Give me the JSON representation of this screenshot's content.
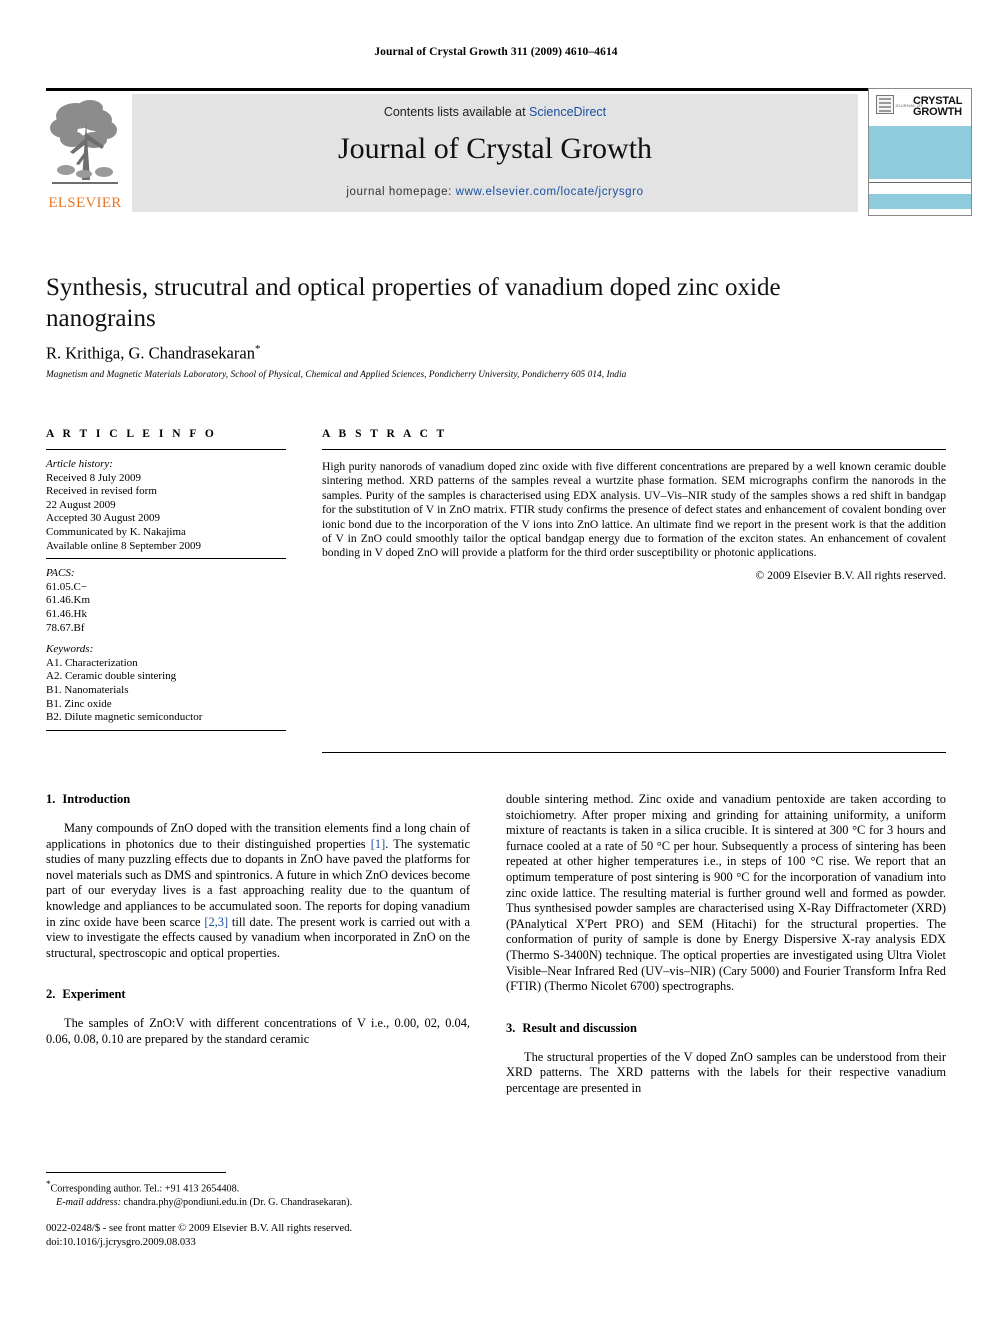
{
  "running_head": "Journal of Crystal Growth 311 (2009) 4610–4614",
  "masthead": {
    "publisher_word": "ELSEVIER",
    "contents_prefix": "Contents lists available at ",
    "contents_link": "ScienceDirect",
    "journal_name": "Journal of Crystal Growth",
    "homepage_prefix": "journal homepage: ",
    "homepage_url": "www.elsevier.com/locate/jcrysgro",
    "cover": {
      "mini_label": "JOURNAL OF",
      "line1": "CRYSTAL",
      "line2": "GROWTH"
    }
  },
  "article": {
    "title": "Synthesis, strucutral and optical properties of vanadium doped zinc oxide nanograins",
    "authors": "R. Krithiga, G. Chandrasekaran",
    "author_marker": "*",
    "affiliation": "Magnetism and Magnetic Materials Laboratory, School of Physical, Chemical and Applied Sciences, Pondicherry University, Pondicherry 605 014, India"
  },
  "article_info": {
    "heading": "A R T I C L E    I N F O",
    "history_label": "Article history:",
    "history": [
      "Received 8 July 2009",
      "Received in revised form",
      "22 August 2009",
      "Accepted 30 August 2009",
      "Communicated by K. Nakajima",
      "Available online 8 September 2009"
    ],
    "pacs_label": "PACS:",
    "pacs": [
      "61.05.C−",
      "61.46.Km",
      "61.46.Hk",
      "78.67.Bf"
    ],
    "keywords_label": "Keywords:",
    "keywords": [
      "A1. Characterization",
      "A2. Ceramic double sintering",
      "B1. Nanomaterials",
      "B1. Zinc oxide",
      "B2. Dilute magnetic semiconductor"
    ]
  },
  "abstract": {
    "heading": "A B S T R A C T",
    "text": "High purity nanorods of vanadium doped zinc oxide with five different concentrations are prepared by a well known ceramic double sintering method. XRD patterns of the samples reveal a wurtzite phase formation. SEM micrographs confirm the nanorods in the samples. Purity of the samples is characterised using EDX analysis. UV–Vis–NIR study of the samples shows a red shift in bandgap for the substitution of V in ZnO matrix. FTIR study confirms the presence of defect states and enhancement of covalent bonding over ionic bond due to the incorporation of the V ions into ZnO lattice. An ultimate find we report in the present work is that the addition of V in ZnO could smoothly tailor the optical bandgap energy due to formation of the exciton states. An enhancement of covalent bonding in V doped ZnO will provide a platform for the third order susceptibility or photonic applications.",
    "copyright": "© 2009 Elsevier B.V. All rights reserved."
  },
  "sections": {
    "intro": {
      "number": "1.",
      "title": "Introduction",
      "p1_a": "Many compounds of ZnO doped with the transition elements find a long chain of applications in photonics due to their distinguished properties ",
      "p1_ref1": "[1]",
      "p1_b": ". The systematic studies of many puzzling effects due to dopants in ZnO have paved the platforms for novel materials such as DMS and spintronics. A future in which ZnO devices become part of our everyday lives is a fast approaching reality due to the quantum of knowledge and appliances to be accumulated soon. The reports for doping vanadium in zinc oxide have been scarce ",
      "p1_ref2": "[2,3]",
      "p1_c": " till date. The present work is carried out with a view to investigate the effects caused by vanadium when incorporated in ZnO on the structural, spectroscopic and optical properties."
    },
    "experiment": {
      "number": "2.",
      "title": "Experiment",
      "p1_left": "The samples of ZnO:V with different concentrations of V i.e., 0.00, 02, 0.04, 0.06, 0.08, 0.10 are prepared by the standard ceramic",
      "p1_right": "double sintering method. Zinc oxide and vanadium pentoxide are taken according to stoichiometry. After proper mixing and grinding for attaining uniformity, a uniform mixture of reactants is taken in a silica crucible. It is sintered at 300 °C for 3 hours and furnace cooled at a rate of 50 °C per hour. Subsequently a process of sintering has been repeated at other higher temperatures i.e., in steps of 100 °C rise. We report that an optimum temperature of post sintering is 900 °C for the incorporation of vanadium into zinc oxide lattice. The resulting material is further ground well and formed as powder. Thus synthesised powder samples are characterised using X-Ray Diffractometer (XRD) (PAnalytical X'Pert PRO) and SEM (Hitachi) for the structural properties. The conformation of purity of sample is done by Energy Dispersive X-ray analysis EDX (Thermo S-3400N) technique. The optical properties are investigated using Ultra Violet Visible–Near Infrared Red (UV–vis–NIR) (Cary 5000) and Fourier Transform Infra Red (FTIR) (Thermo Nicolet 6700) spectrographs."
    },
    "result": {
      "number": "3.",
      "title": "Result and discussion",
      "p1": "The structural properties of the V doped ZnO samples can be understood from their XRD patterns. The XRD patterns with the labels for their respective vanadium percentage are presented in"
    }
  },
  "footnotes": {
    "corresponding_marker": "*",
    "corresponding": "Corresponding author. Tel.: +91 413 2654408.",
    "email_label": "E-mail address:",
    "email": "chandra.phy@pondiuni.edu.in (Dr. G. Chandrasekaran).",
    "issn_line": "0022-0248/$ - see front matter © 2009 Elsevier B.V. All rights reserved.",
    "doi_line": "doi:10.1016/j.jcrysgro.2009.08.033"
  },
  "colors": {
    "link": "#1a4fa0",
    "elsevier_orange": "#E87722",
    "cover_blue": "#8ecbdd",
    "masthead_gray": "#e3e3e3"
  }
}
